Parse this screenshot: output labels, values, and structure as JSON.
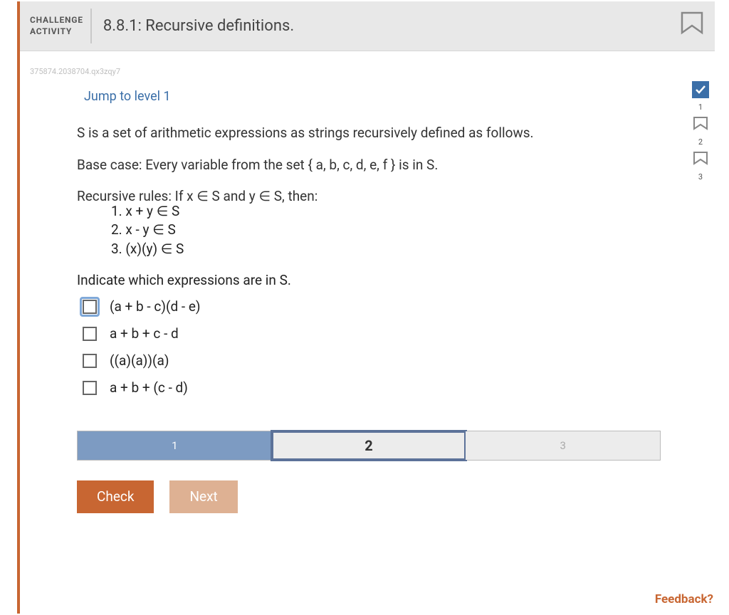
{
  "header": {
    "label_line1": "CHALLENGE",
    "label_line2": "ACTIVITY",
    "title": "8.8.1: Recursive definitions."
  },
  "qid": "375874.2038704.qx3zqy7",
  "jump_text": "Jump to level 1",
  "problem": {
    "intro": "S is a set of arithmetic expressions as strings recursively defined as follows.",
    "base_case": "Base case: Every variable from the set { a, b, c, d, e, f } is in S.",
    "rules_header": "Recursive rules: If x ∈ S and y ∈ S, then:",
    "rules": [
      "1. x + y ∈ S",
      "2. x - y ∈ S",
      "3. (x)(y) ∈ S"
    ],
    "prompt": "Indicate which expressions are in S.",
    "options": [
      "(a + b - c)(d - e)",
      "a + b + c - d",
      "((a)(a))(a)",
      "a + b + (c - d)"
    ]
  },
  "steps": {
    "items": [
      "1",
      "2",
      "3"
    ],
    "done_index": 0,
    "current_index": 1
  },
  "buttons": {
    "check": "Check",
    "next": "Next"
  },
  "levels": {
    "items": [
      "1",
      "2",
      "3"
    ],
    "completed_index": 0
  },
  "feedback_label": "Feedback?"
}
